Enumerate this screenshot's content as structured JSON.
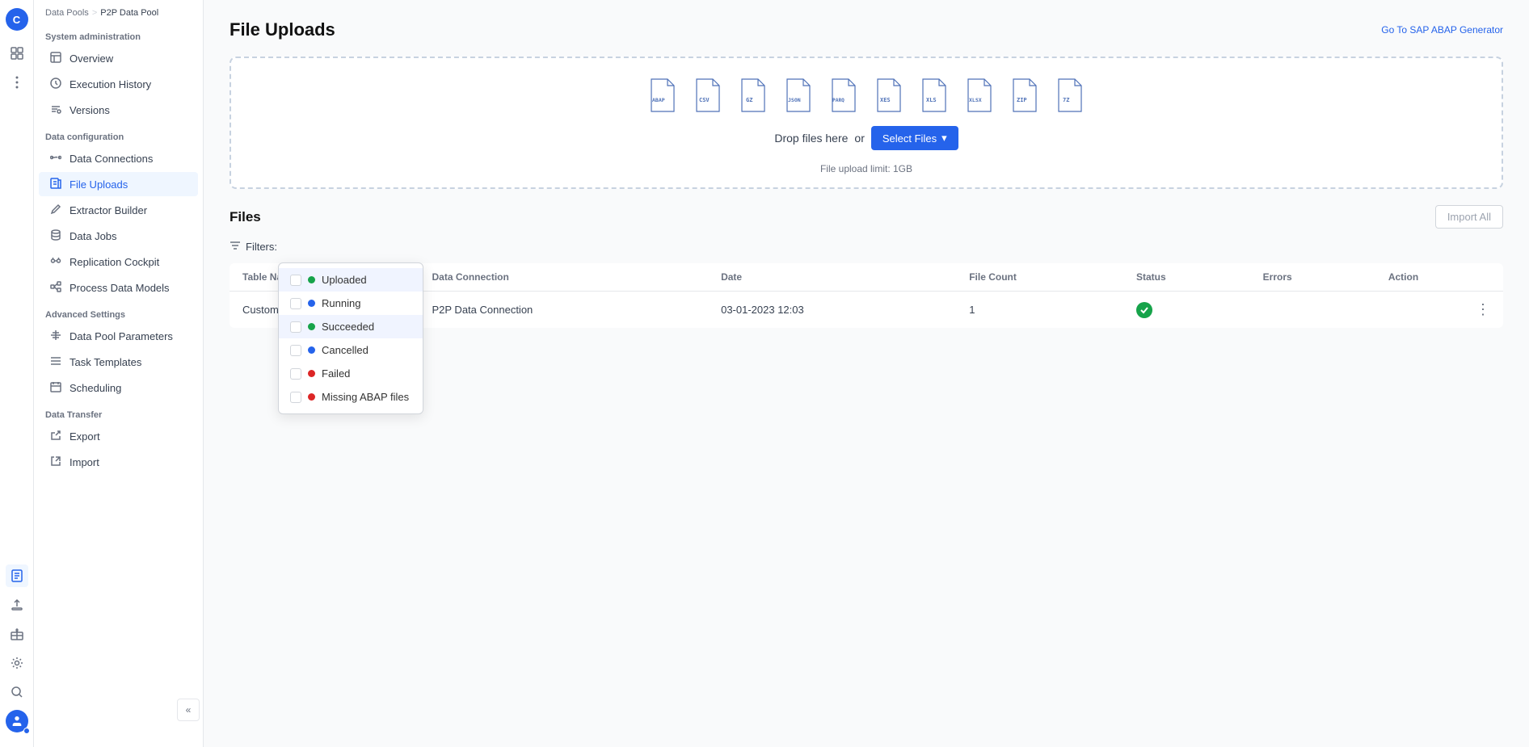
{
  "breadcrumb": {
    "pool": "Data Pools",
    "separator": ">",
    "current": "P2P Data Pool"
  },
  "sidebar": {
    "system_admin_label": "System administration",
    "data_config_label": "Data configuration",
    "advanced_settings_label": "Advanced Settings",
    "data_transfer_label": "Data Transfer",
    "items": {
      "overview": "Overview",
      "execution_history": "Execution History",
      "versions": "Versions",
      "data_connections": "Data Connections",
      "file_uploads": "File Uploads",
      "extractor_builder": "Extractor Builder",
      "data_jobs": "Data Jobs",
      "replication_cockpit": "Replication Cockpit",
      "process_data_models": "Process Data Models",
      "data_pool_parameters": "Data Pool Parameters",
      "task_templates": "Task Templates",
      "scheduling": "Scheduling",
      "export": "Export",
      "import": "Import"
    }
  },
  "header": {
    "title": "File Uploads",
    "go_to_link": "Go To SAP ABAP Generator"
  },
  "upload_area": {
    "file_types": [
      "ABAP",
      "CSV",
      "GZ",
      "JSON",
      "PARQ",
      "XES",
      "XLS",
      "XLSX",
      "ZIP",
      "7Z"
    ],
    "drop_text": "Drop files here",
    "or_text": "or",
    "select_button": "Select Files",
    "limit_text": "File upload limit: 1GB"
  },
  "files_section": {
    "title": "Files",
    "import_all_button": "Import All"
  },
  "filters": {
    "label": "Filters:",
    "options": [
      {
        "id": "uploaded",
        "label": "Uploaded",
        "dot_color": "green",
        "checked": false,
        "highlighted": true
      },
      {
        "id": "running",
        "label": "Running",
        "dot_color": "blue",
        "checked": false,
        "highlighted": false
      },
      {
        "id": "succeeded",
        "label": "Succeeded",
        "dot_color": "green",
        "checked": false,
        "highlighted": true
      },
      {
        "id": "cancelled",
        "label": "Cancelled",
        "dot_color": "blue",
        "checked": false,
        "highlighted": false
      },
      {
        "id": "failed",
        "label": "Failed",
        "dot_color": "red",
        "checked": false,
        "highlighted": false
      },
      {
        "id": "missing_abap",
        "label": "Missing ABAP files",
        "dot_color": "red",
        "checked": false,
        "highlighted": false
      }
    ]
  },
  "table": {
    "columns": [
      "Table Name",
      "Data Connection",
      "Date",
      "File Count",
      "Status",
      "Errors",
      "Action"
    ],
    "rows": [
      {
        "table_name": "Customer_d",
        "data_connection": "P2P Data Connection",
        "date": "03-01-2023 12:03",
        "file_count": "1",
        "status": "success",
        "errors": "",
        "action": "..."
      }
    ]
  },
  "icons": {
    "logo": "C",
    "grid": "⊞",
    "clock": "🕐",
    "tag": "🏷",
    "filter": "⊟",
    "chevron_down": "▾",
    "chevron_left": "«",
    "dots": "⋮"
  }
}
